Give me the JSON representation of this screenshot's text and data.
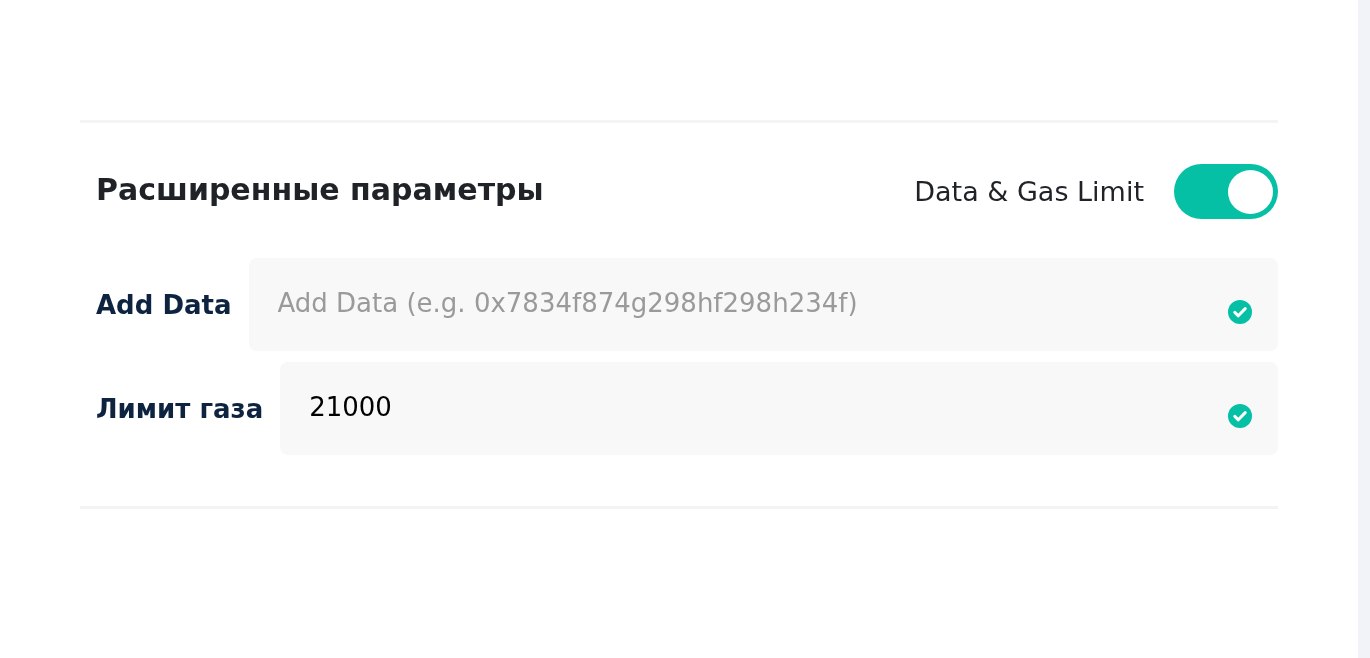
{
  "section": {
    "title": "Расширенные параметры",
    "toggle": {
      "label": "Data & Gas Limit",
      "on": true
    }
  },
  "fields": [
    {
      "label": "Add Data",
      "placeholder": "Add Data (e.g. 0x7834f874g298hf298h234f)",
      "valid": true
    },
    {
      "label": "Лимит газа",
      "value": "21000",
      "valid": true
    }
  ]
}
